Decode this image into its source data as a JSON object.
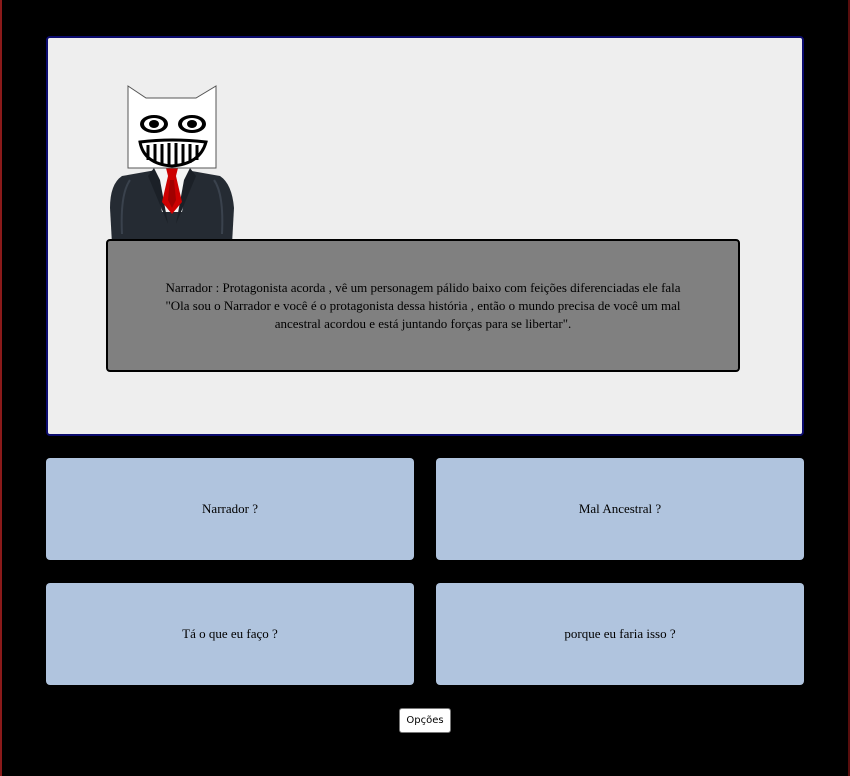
{
  "scene": {
    "character": "narrator",
    "dialogue": "Narrador : Protagonista acorda , vê um personagem pálido baixo com feições diferenciadas ele fala \"Ola sou o Narrador e você é o protagonista dessa história , então o mundo precisa de você um mal ancestral acordou e está juntando forças para se libertar\"."
  },
  "choices": [
    {
      "label": "Narrador ?"
    },
    {
      "label": "Mal Ancestral ?"
    },
    {
      "label": "Tá o que eu faço ?"
    },
    {
      "label": "porque eu faria isso ?"
    }
  ],
  "options_label": "Opções",
  "colors": {
    "background": "#000000",
    "scene_panel": "#eeeeee",
    "scene_border": "#0c0c6e",
    "dialogue_box": "#808080",
    "choice_button": "#b0c4de",
    "tie": "#cc0000",
    "suit": "#252b33"
  }
}
